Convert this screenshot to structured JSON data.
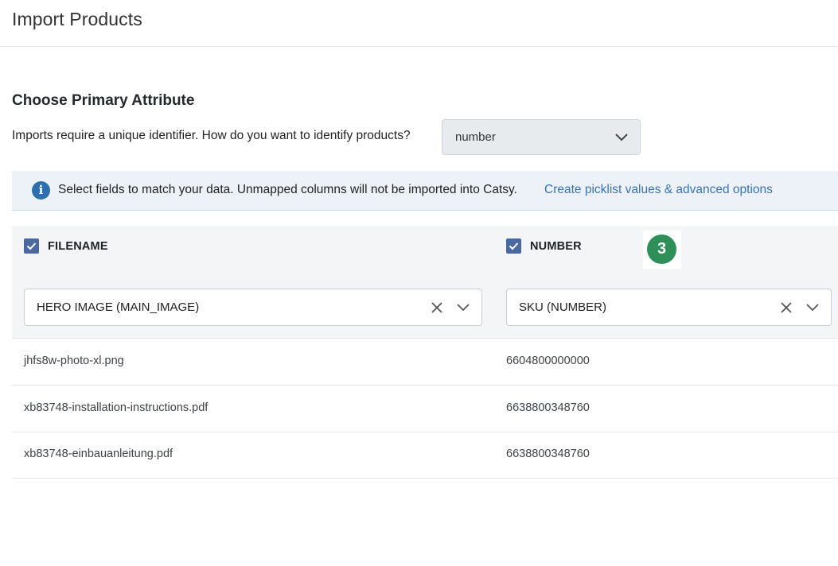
{
  "header": {
    "title": "Import Products"
  },
  "primary_attribute": {
    "heading": "Choose Primary Attribute",
    "question": "Imports require a unique identifier. How do you want to identify products?",
    "selected": "number"
  },
  "info": {
    "text": "Select fields to match your data. Unmapped columns will not be imported into Catsy.",
    "link": "Create picklist values & advanced options"
  },
  "columns": [
    {
      "name": "FILENAME",
      "checked": true,
      "mapped_to": "HERO IMAGE (MAIN_IMAGE)"
    },
    {
      "name": "NUMBER",
      "checked": true,
      "mapped_to": "SKU (NUMBER)"
    }
  ],
  "step_badge": "3",
  "rows": [
    {
      "filename": "jhfs8w-photo-xl.png",
      "number": "6604800000000"
    },
    {
      "filename": "xb83748-installation-instructions.pdf",
      "number": "6638800348760"
    },
    {
      "filename": "xb83748-einbauanleitung.pdf",
      "number": "6638800348760"
    }
  ],
  "colors": {
    "accent": "#4a69a3",
    "link": "#3a72b0",
    "badge": "#2f8f58",
    "info_bg": "#edf2f8"
  }
}
